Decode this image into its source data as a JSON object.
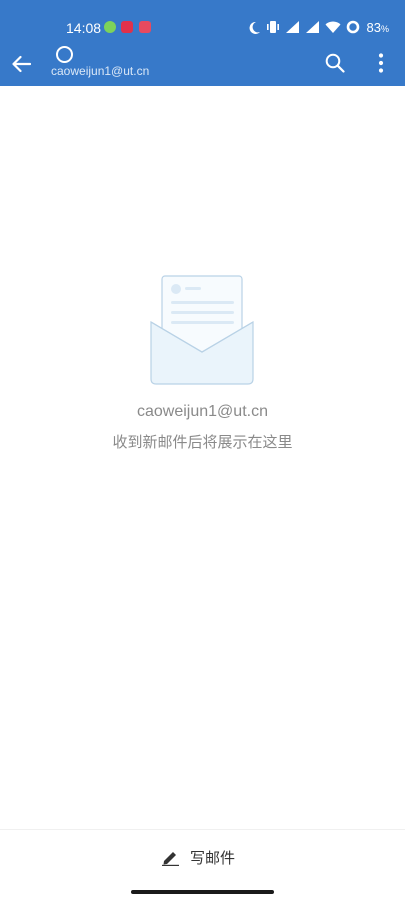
{
  "status_bar": {
    "time": "14:08",
    "battery": "83",
    "battery_unit": "%",
    "app_icons": [
      {
        "name": "wechat-icon",
        "color": "#7dd35a"
      },
      {
        "name": "tiktok-icon",
        "color": "#e0314b"
      },
      {
        "name": "calendar-app-icon",
        "color": "#e84a5f"
      }
    ]
  },
  "header": {
    "account_email": "caoweijun1@ut.cn",
    "background": "#3779c9"
  },
  "empty_state": {
    "email": "caoweijun1@ut.cn",
    "message": "收到新邮件后将展示在这里",
    "illustration": "open-envelope-with-letter"
  },
  "compose": {
    "label": "写邮件",
    "icon": "pencil-icon"
  }
}
